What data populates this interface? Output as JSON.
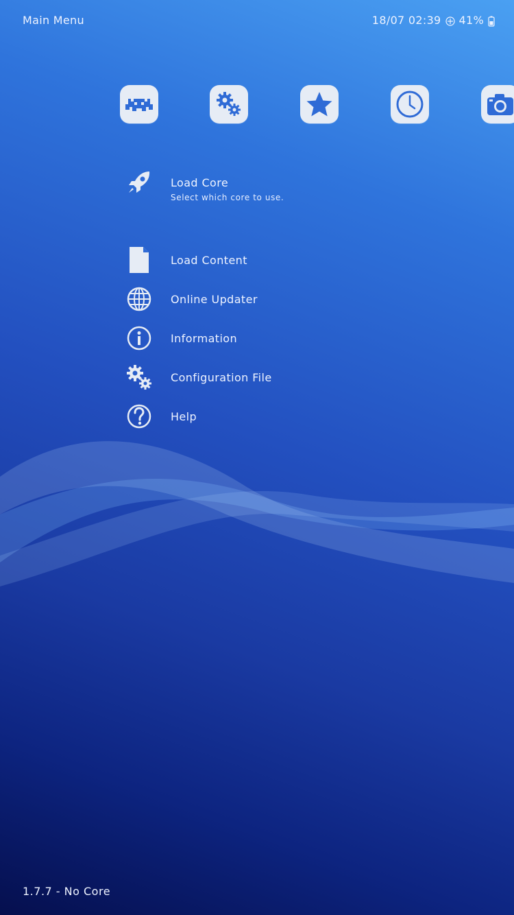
{
  "header": {
    "title": "Main Menu"
  },
  "status": {
    "datetime": "18/07 02:39",
    "battery": "41%"
  },
  "tabs": [
    {
      "name": "main-menu",
      "icon": "retroarch-invader-icon"
    },
    {
      "name": "settings",
      "icon": "gears-icon"
    },
    {
      "name": "favorites",
      "icon": "star-icon"
    },
    {
      "name": "history",
      "icon": "clock-icon"
    },
    {
      "name": "images",
      "icon": "camera-icon"
    }
  ],
  "menu": {
    "items": [
      {
        "label": "Load Core",
        "sublabel": "Select which core to use.",
        "icon": "rocket-icon"
      },
      {
        "label": "Load Content",
        "icon": "file-icon"
      },
      {
        "label": "Online Updater",
        "icon": "globe-icon"
      },
      {
        "label": "Information",
        "icon": "info-icon"
      },
      {
        "label": "Configuration File",
        "icon": "gears-icon"
      },
      {
        "label": "Help",
        "icon": "help-icon"
      }
    ]
  },
  "footer": {
    "version": "1.7.7 - No Core"
  },
  "colors": {
    "icon_fill": "#e6ecf5",
    "icon_glyph": "#2f6bd6",
    "text": "#eef3ff"
  }
}
